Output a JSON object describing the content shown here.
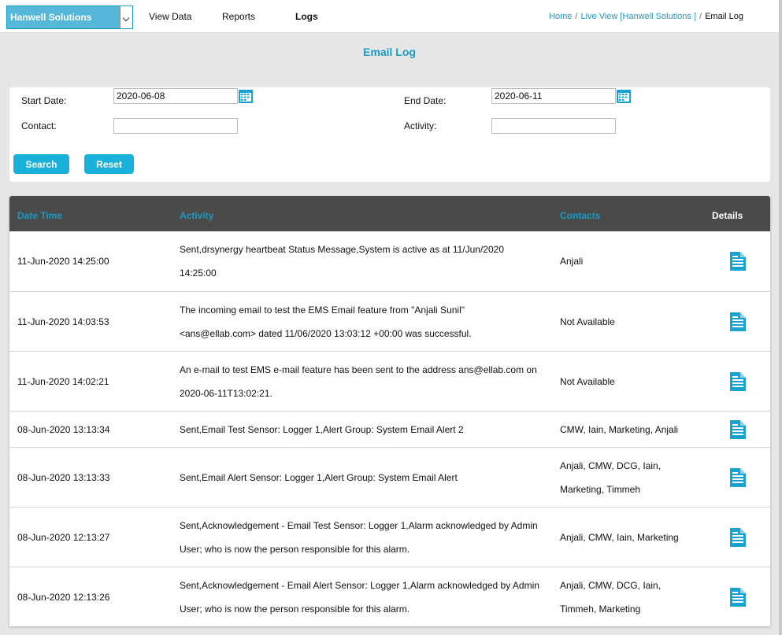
{
  "header": {
    "org_select": "Hanwell Solutions",
    "nav": [
      "View Data",
      "Reports",
      "Logs"
    ],
    "active_nav": "Logs",
    "breadcrumb": [
      "Home",
      "Live View [Hanwell Solutions ]",
      "Email Log"
    ]
  },
  "page": {
    "title": "Email Log"
  },
  "filters": {
    "start_date_label": "Start Date:",
    "start_date_value": "2020-06-08",
    "end_date_label": "End Date:",
    "end_date_value": "2020-06-11",
    "contact_label": "Contact:",
    "contact_value": "",
    "activity_label": "Activity:",
    "activity_value": "",
    "search_label": "Search",
    "reset_label": "Reset"
  },
  "table": {
    "columns": [
      "Date Time",
      "Activity",
      "Contacts",
      "Details"
    ],
    "rows": [
      {
        "datetime": "11-Jun-2020 14:25:00",
        "activity": "Sent,drsynergy heartbeat Status Message,System is active as at 11/Jun/2020 14:25:00",
        "contacts": "Anjali"
      },
      {
        "datetime": "11-Jun-2020 14:03:53",
        "activity": "The incoming email to test the EMS Email feature from \"Anjali Sunil\" <ans@ellab.com> dated 11/06/2020 13:03:12 +00:00 was successful.",
        "contacts": "Not Available"
      },
      {
        "datetime": "11-Jun-2020 14:02:21",
        "activity": "An e-mail to test EMS e-mail feature has been sent to the address ans@ellab.com on 2020-06-11T13:02:21.",
        "contacts": "Not Available"
      },
      {
        "datetime": "08-Jun-2020 13:13:34",
        "activity": "Sent,Email Test Sensor: Logger 1,Alert Group: System Email Alert 2",
        "contacts": "CMW, Iain, Marketing, Anjali"
      },
      {
        "datetime": "08-Jun-2020 13:13:33",
        "activity": "Sent,Email Alert Sensor: Logger 1,Alert Group: System Email Alert",
        "contacts": "Anjali, CMW, DCG, Iain, Marketing, Timmeh"
      },
      {
        "datetime": "08-Jun-2020 12:13:27",
        "activity": "Sent,Acknowledgement - Email Test Sensor: Logger 1,Alarm acknowledged by Admin User; who is now the person responsible for this alarm.",
        "contacts": "Anjali, CMW, Iain, Marketing"
      },
      {
        "datetime": "08-Jun-2020 12:13:26",
        "activity": "Sent,Acknowledgement - Email Alert Sensor: Logger 1,Alarm acknowledged by Admin User; who is now the person responsible for this alarm.",
        "contacts": "Anjali, CMW, DCG, Iain, Timmeh, Marketing"
      }
    ]
  },
  "colors": {
    "accent": "#1a9bc4",
    "button": "#19b1d9",
    "header_bg": "#4a4a4a"
  }
}
